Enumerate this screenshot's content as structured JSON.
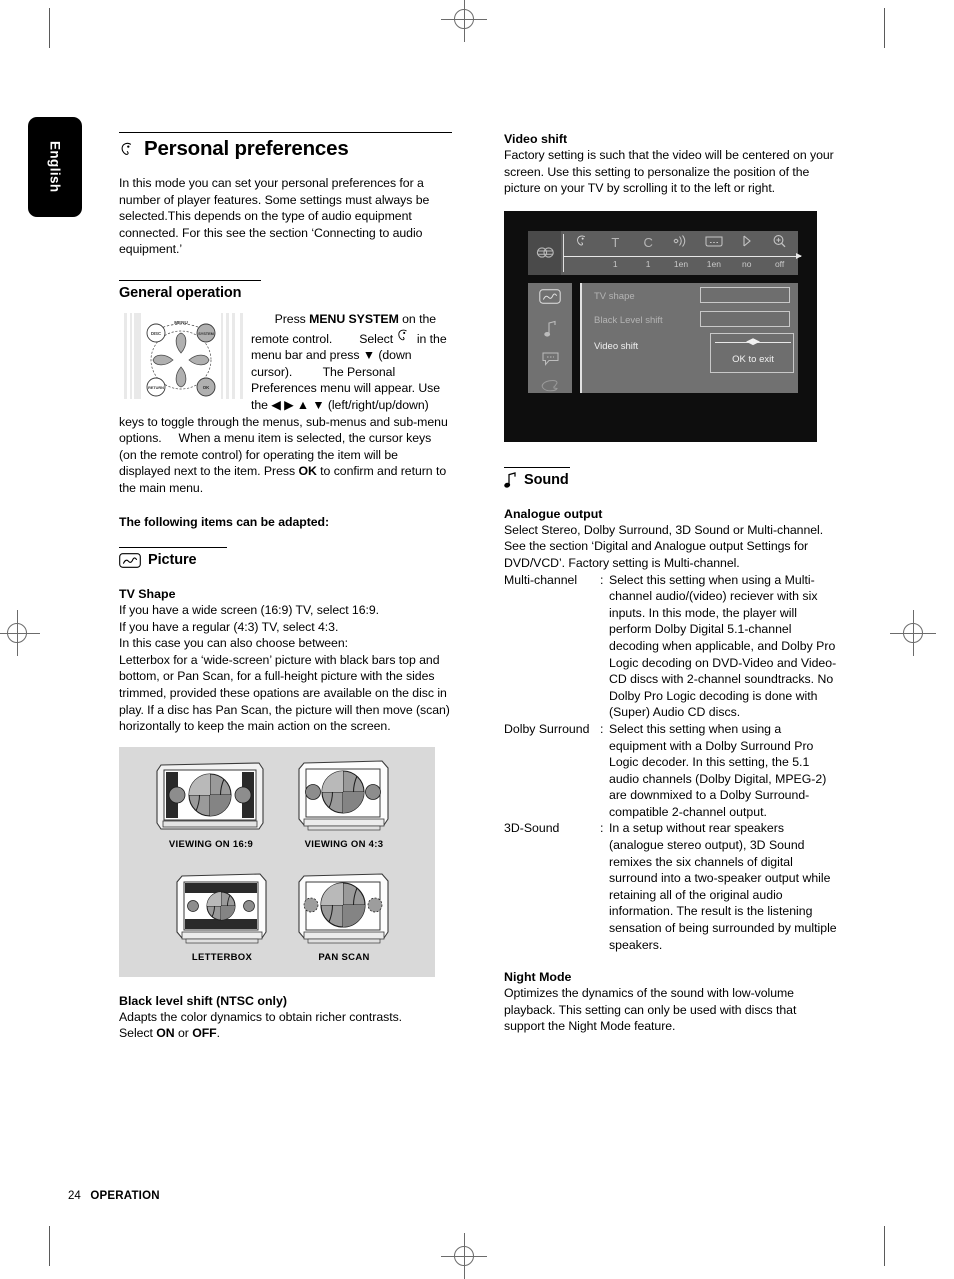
{
  "page": {
    "language_tab": "English",
    "footer_number": "24",
    "footer_label": "OPERATION"
  },
  "left_column": {
    "title": "Personal preferences",
    "title_icon": "personal-preferences-icon",
    "intro": "In this mode you can set your personal preferences for a number of player features. Some settings must always be selected.This depends on the type of audio equipment connected. For this see the section ‘Connecting to audio equipment.’",
    "general_operation": {
      "heading": "General operation",
      "step1_pre": "Press ",
      "step1_bold": "MENU SYSTEM",
      "step1_post": " on the remote control.",
      "step2_pre": "Select ",
      "step2_post": " in the menu bar and press ▼ (down cursor).",
      "step3": "The Personal Preferences menu will appear.",
      "step4": "Use the ◀ ▶ ▲ ▼ (left/right/up/down) keys to toggle through the menus, sub-menus and sub-menu options.",
      "step5": "When a menu item is selected, the cursor keys (on the remote control) for operating the item will be displayed next to the item.",
      "step6_pre": "Press ",
      "step6_bold": "OK",
      "step6_post": " to confirm and return to the main menu."
    },
    "following_items": "The following items can be adapted:",
    "picture": {
      "heading": "Picture",
      "icon": "picture-icon",
      "tv_shape_heading": "TV Shape",
      "tv_shape_body": "If you have a wide screen (16:9) TV, select 16:9.\nIf you have a regular (4:3) TV, select 4:3.\nIn this case you can also choose between:\nLetterbox for a ‘wide-screen’ picture with black bars top and bottom, or Pan Scan, for a full-height picture with the sides trimmed, provided these opations are available on the disc in play. If a disc has Pan Scan, the picture will then move (scan) horizontally to keep the main action on the screen."
    },
    "tv_figures": [
      {
        "caption": "VIEWING ON 16:9",
        "mode": "widescreen"
      },
      {
        "caption": "VIEWING ON 4:3",
        "mode": "regular"
      },
      {
        "caption": "LETTERBOX",
        "mode": "letterbox"
      },
      {
        "caption": "PAN SCAN",
        "mode": "panscan"
      }
    ],
    "black_level": {
      "heading": "Black level shift (NTSC only)",
      "body_line1": "Adapts the color dynamics to obtain richer contrasts.",
      "body_line2_pre": "Select ",
      "body_line2_on": "ON",
      "body_line2_mid": " or ",
      "body_line2_off": "OFF",
      "body_line2_post": "."
    },
    "remote": {
      "label_disc": "DISC",
      "label_menu": "MENU",
      "label_system": "SYSTEM",
      "label_return": "RETURN",
      "label_ok": "OK"
    }
  },
  "right_column": {
    "video_shift": {
      "heading": "Video shift",
      "body": "Factory setting is such that the video will be centered on your screen. Use this setting to personalize the position of the picture on your TV by scrolling it to the left or right."
    },
    "osd": {
      "menubar_icons": [
        "preferences-icon",
        "title-icon",
        "chapter-icon",
        "audio-icon",
        "subtitle-icon",
        "angle-icon",
        "zoom-icon"
      ],
      "menubar_left_icon": "globe-icon",
      "menubar_values": [
        "",
        "1",
        "1",
        "1en",
        "1en",
        "no",
        "off"
      ],
      "sidebar_icons": [
        "picture-icon",
        "sound-icon",
        "language-icon",
        "features-icon"
      ],
      "rows": [
        "TV shape",
        "Black Level shift",
        "Video shift"
      ],
      "slider_marker": "◀▶",
      "exit_label": "OK to exit"
    },
    "sound": {
      "heading": "Sound",
      "icon": "note-icon",
      "analogue_heading": "Analogue output",
      "analogue_body": "Select Stereo, Dolby Surround, 3D Sound or Multi-channel. See the section ‘Digital and Analogue output Settings for DVD/VCD’. Factory setting is Multi-channel.",
      "options": [
        {
          "term": "Multi-channel",
          "colon": ":",
          "definition": "Select this setting when using a Multi-channel audio/(video) reciever with six inputs. In this mode, the player will perform Dolby Digital 5.1-channel decoding when applicable, and Dolby Pro Logic decoding on DVD-Video and Video-CD discs with 2-channel soundtracks. No Dolby Pro Logic decoding is done with (Super) Audio CD discs."
        },
        {
          "term": "Dolby Surround",
          "colon": ":",
          "definition": "Select this setting when using a equipment with a Dolby Surround Pro Logic decoder. In this setting, the 5.1 audio channels (Dolby Digital, MPEG-2) are downmixed to a Dolby Surround-compatible 2-channel output."
        },
        {
          "term": "3D-Sound",
          "colon": ":",
          "definition": "In a setup without rear speakers (analogue stereo output), 3D Sound remixes the six channels of digital surround into a two-speaker output while retaining all of the original audio information. The result is the listening sensation of being surrounded by multiple speakers."
        }
      ],
      "night_heading": "Night Mode",
      "night_body": "Optimizes the dynamics of the sound with low-volume playback. This setting can only be used with discs that support the Night Mode feature."
    }
  },
  "colors": {
    "panel_bg": "#d9d9d9",
    "osd_bg": "#0e0e0e",
    "osd_panel": "#717171",
    "osd_bar": "#5e5e5e"
  }
}
